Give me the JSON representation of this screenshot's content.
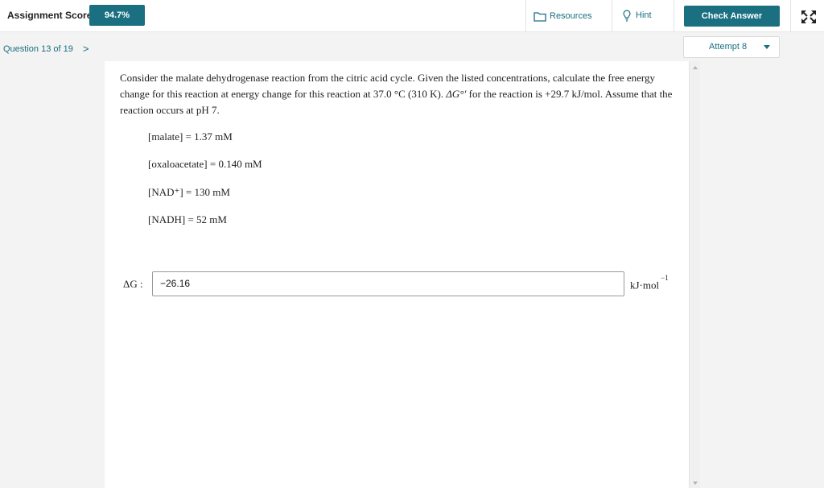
{
  "header": {
    "score_label": "Assignment Score:",
    "score_value": "94.7%",
    "resources_label": "Resources",
    "hint_label": "Hint",
    "check_answer_label": "Check Answer"
  },
  "nav": {
    "question_position": "Question 13 of 19",
    "next_arrow": ">",
    "attempt_label": "Attempt 8"
  },
  "question": {
    "text_part1": "Consider the malate dehydrogenase reaction from the citric acid cycle. Given the listed concentrations, calculate the free energy change for this reaction at energy change for this reaction at 37.0 °C (310 K). ",
    "delta_g_symbol": "ΔG°′",
    "text_part2": " for the reaction is +29.7 kJ/mol. Assume that the reaction occurs at pH 7.",
    "concentrations": [
      "[malate] = 1.37 mM",
      "[oxaloacetate] = 0.140 mM",
      "[NAD⁺] = 130 mM",
      "[NADH] = 52 mM"
    ]
  },
  "answer": {
    "label": "ΔG :",
    "value": "−26.16",
    "unit_base": "kJ·mol",
    "unit_exp": "−1"
  },
  "colors": {
    "accent": "#1a6f81"
  },
  "icons": {
    "resources": "folder-icon",
    "hint": "lightbulb-icon",
    "expand": "expand-icon",
    "next": "chevron-right-icon",
    "attempt_dropdown": "caret-down-icon"
  }
}
